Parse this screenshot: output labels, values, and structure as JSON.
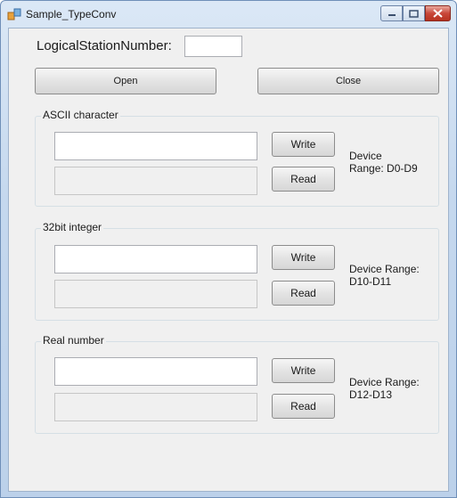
{
  "window": {
    "title": "Sample_TypeConv"
  },
  "station": {
    "label": "LogicalStationNumber:",
    "value": ""
  },
  "buttons": {
    "open": "Open",
    "close": "Close"
  },
  "groups": [
    {
      "title": "ASCII character",
      "write": "Write",
      "read": "Read",
      "range_line1": "Device",
      "range_line2": "Range: D0-D9",
      "write_value": "",
      "read_value": ""
    },
    {
      "title": "32bit integer",
      "write": "Write",
      "read": "Read",
      "range_line1": "Device Range:",
      "range_line2": "D10-D11",
      "write_value": "",
      "read_value": ""
    },
    {
      "title": "Real number",
      "write": "Write",
      "read": "Read",
      "range_line1": "Device Range:",
      "range_line2": "D12-D13",
      "write_value": "",
      "read_value": ""
    }
  ]
}
